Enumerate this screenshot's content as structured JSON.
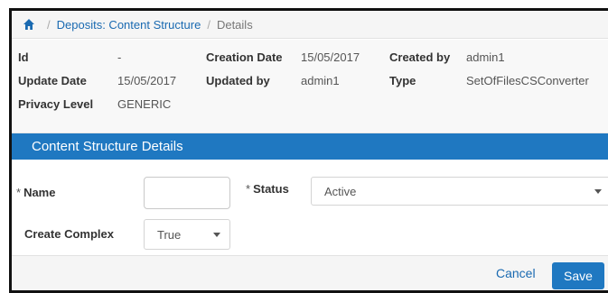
{
  "breadcrumb": {
    "items": [
      "Deposits: Content Structure",
      "Details"
    ],
    "separator": "/"
  },
  "info": {
    "id": {
      "label": "Id",
      "value": "-"
    },
    "creation_date": {
      "label": "Creation Date",
      "value": "15/05/2017"
    },
    "created_by": {
      "label": "Created by",
      "value": "admin1"
    },
    "update_date": {
      "label": "Update Date",
      "value": "15/05/2017"
    },
    "updated_by": {
      "label": "Updated by",
      "value": "admin1"
    },
    "type": {
      "label": "Type",
      "value": "SetOfFilesCSConverter"
    },
    "privacy_level": {
      "label": "Privacy Level",
      "value": "GENERIC"
    }
  },
  "panel": {
    "title": "Content Structure Details"
  },
  "form": {
    "required_mark": "*",
    "name": {
      "label": "Name",
      "value": ""
    },
    "status": {
      "label": "Status",
      "value": "Active"
    },
    "create_complex": {
      "label": "Create Complex",
      "value": "True"
    }
  },
  "actions": {
    "cancel_label": "Cancel",
    "save_label": "Save"
  },
  "colors": {
    "accent": "#1f78c1",
    "link": "#1a6ab1"
  },
  "icons": {
    "home": "home-icon",
    "dropdown": "chevron-down-icon"
  }
}
